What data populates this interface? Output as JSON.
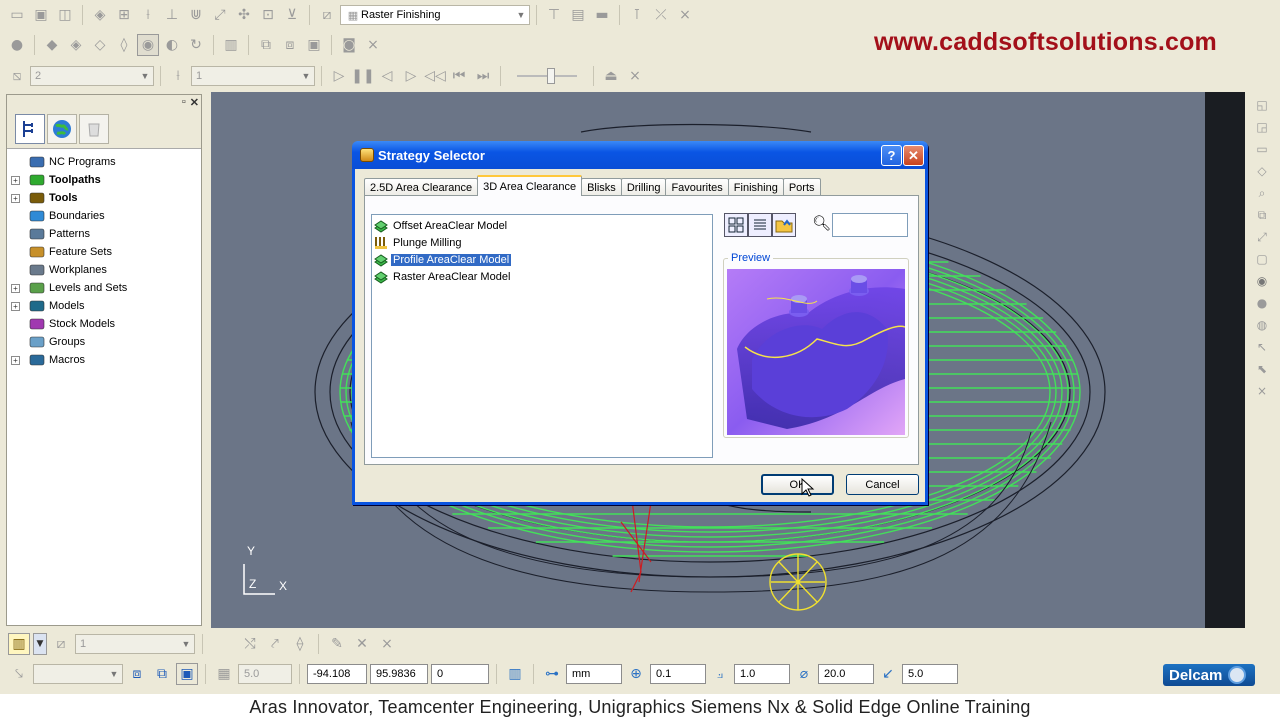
{
  "watermark": {
    "url": "www.caddsoftsolutions.com"
  },
  "toolbar1": {
    "strategy_combo": "Raster Finishing"
  },
  "toolbar3": {
    "combo_a": "2",
    "combo_b": "1"
  },
  "explorer": {
    "items": [
      {
        "label": "NC Programs",
        "bold": false,
        "expand": false
      },
      {
        "label": "Toolpaths",
        "bold": true,
        "expand": true
      },
      {
        "label": "Tools",
        "bold": true,
        "expand": true
      },
      {
        "label": "Boundaries",
        "bold": false,
        "expand": false
      },
      {
        "label": "Patterns",
        "bold": false,
        "expand": false
      },
      {
        "label": "Feature Sets",
        "bold": false,
        "expand": false
      },
      {
        "label": "Workplanes",
        "bold": false,
        "expand": false
      },
      {
        "label": "Levels and Sets",
        "bold": false,
        "expand": true
      },
      {
        "label": "Models",
        "bold": false,
        "expand": true
      },
      {
        "label": "Stock Models",
        "bold": false,
        "expand": false
      },
      {
        "label": "Groups",
        "bold": false,
        "expand": false
      },
      {
        "label": "Macros",
        "bold": false,
        "expand": true
      }
    ]
  },
  "axis": {
    "y": "Y",
    "x": "X",
    "z": "Z"
  },
  "dialog": {
    "title": "Strategy Selector",
    "help": "?",
    "close": "✕",
    "tabs": [
      "2.5D Area Clearance",
      "3D Area Clearance",
      "Blisks",
      "Drilling",
      "Favourites",
      "Finishing",
      "Ports"
    ],
    "active_tab": 1,
    "strategies": [
      {
        "label": "Offset AreaClear Model",
        "selected": false
      },
      {
        "label": "Plunge Milling",
        "selected": false
      },
      {
        "label": "Profile AreaClear Model",
        "selected": true
      },
      {
        "label": "Raster AreaClear Model",
        "selected": false
      }
    ],
    "preview_label": "Preview",
    "search_value": "",
    "ok_label": "OK",
    "cancel_label": "Cancel"
  },
  "bottom1": {
    "combo_value": "1"
  },
  "bottom2": {
    "grid_value": "5.0",
    "x": "-94.108",
    "y": "95.9836",
    "z": "0",
    "units": "mm",
    "tolerance": "0.1",
    "tool_length": "1.0",
    "diameter": "20.0",
    "angle": "5.0"
  },
  "brand": {
    "delcam": "Delcam"
  },
  "caption": "Aras Innovator, Teamcenter Engineering, Unigraphics Siemens Nx & Solid Edge Online Training",
  "colors": {
    "toolpath_green": "#43e05a",
    "highlight": "#316ac5",
    "xp_blue": "#0a54e0"
  }
}
